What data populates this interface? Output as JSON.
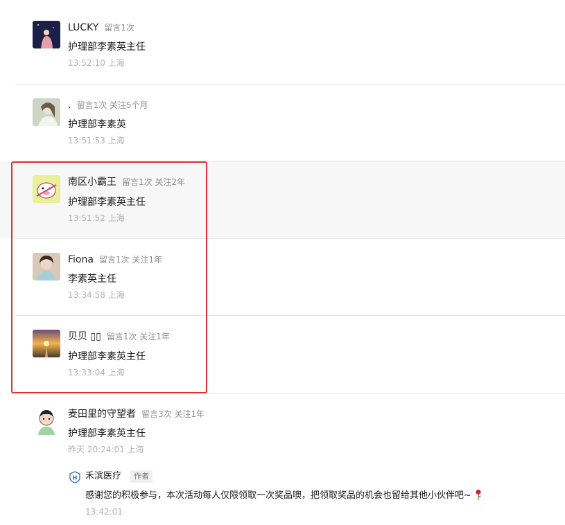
{
  "comments": [
    {
      "name": "LUCKY",
      "meta": "留言1次",
      "text": "护理部李素英主任",
      "time": "13:52:10 上海",
      "avatar": "avatar-night-girl"
    },
    {
      "name": ".",
      "meta": "留言1次 关注5个月",
      "text": "护理部李素英",
      "time": "13:51:53 上海",
      "avatar": "avatar-woman-photo"
    },
    {
      "name": "南区小霸王",
      "meta": "留言1次 关注2年",
      "text": "护理部李素英主任",
      "time": "13:51:52 上海",
      "avatar": "avatar-cartoon-pig"
    },
    {
      "name": "Fiona",
      "meta": "留言1次 关注1年",
      "text": "李素英主任",
      "time": "13:34:58 上海",
      "avatar": "avatar-woman-smile"
    },
    {
      "name": "贝贝 ▯▯",
      "meta": "留言1次 关注1年",
      "text": "护理部李素英主任",
      "time": "13:33:04 上海",
      "avatar": "avatar-sunset-road"
    },
    {
      "name": "麦田里的守望者",
      "meta": "留言3次 关注1年",
      "text": "护理部李素英主任",
      "time": "昨天 20:24:01 上海",
      "avatar": "avatar-cartoon-boy"
    }
  ],
  "reply": {
    "name": "禾滨医疗",
    "badge": "作者",
    "text": "感谢您的积极参与，本次活动每人仅限领取一次奖品噢，把领取奖品的机会也留给其他小伙伴吧~",
    "emoji": "rose-icon",
    "time": "13:42:01"
  },
  "colors": {
    "highlight_box": "#e0322d",
    "time_text": "#b2b2b2",
    "meta_text": "#8f8f8f"
  }
}
